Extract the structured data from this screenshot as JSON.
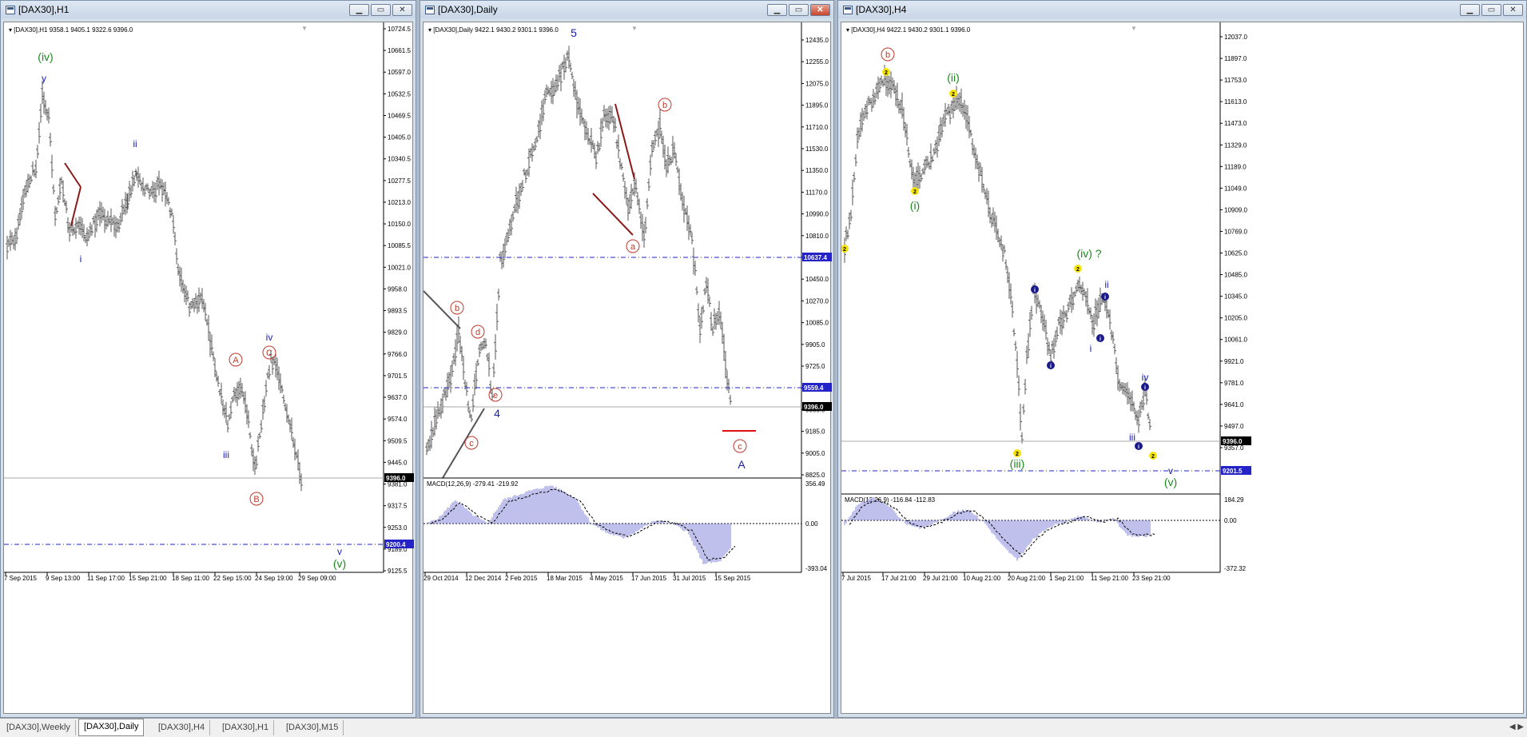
{
  "windows": [
    {
      "title": "[DAX30],H1",
      "info": "[DAX30],H1  9358.1 9405.1 9322.6 9396.0",
      "price_levels": [
        "10724.5",
        "10661.5",
        "10597.0",
        "10532.5",
        "10469.5",
        "10405.0",
        "10340.5",
        "10277.5",
        "10213.0",
        "10150.0",
        "10085.5",
        "10021.0",
        "9958.0",
        "9893.5",
        "9829.0",
        "9766.0",
        "9701.5",
        "9637.0",
        "9574.0",
        "9509.5",
        "9445.0",
        "9381.0",
        "9317.5",
        "9253.0",
        "9189.0",
        "9125.5"
      ],
      "time_labels": [
        "7 Sep 2015",
        "9 Sep 13:00",
        "11 Sep 17:00",
        "15 Sep 21:00",
        "18 Sep 11:00",
        "22 Sep 15:00",
        "24 Sep 19:00",
        "29 Sep 09:00"
      ],
      "hlines": [
        {
          "label": "9200.4",
          "value": 9200.4
        }
      ],
      "current_price": "9396.0",
      "wave_labels": {
        "iv_green": "(iv)",
        "y": "y",
        "ii": "ii",
        "i": "i",
        "iii": "iii",
        "A_circ": "A",
        "B_circ": "B",
        "C_circ": "C",
        "iv": "iv",
        "v": "v",
        "v_green": "(v)"
      }
    },
    {
      "title": "[DAX30],Daily",
      "info": "[DAX30],Daily  9422.1 9430.2 9301.1 9396.0",
      "price_levels": [
        "12435.0",
        "12255.0",
        "12075.0",
        "11895.0",
        "11710.0",
        "11530.0",
        "11350.0",
        "11170.0",
        "10990.0",
        "10810.0",
        "10630.0",
        "10450.0",
        "10270.0",
        "10085.0",
        "9905.0",
        "9725.0",
        "9545.0",
        "9365.0",
        "9185.0",
        "9005.0",
        "8825.0"
      ],
      "time_labels": [
        "29 Oct 2014",
        "12 Dec 2014",
        "2 Feb 2015",
        "18 Mar 2015",
        "4 May 2015",
        "17 Jun 2015",
        "31 Jul 2015",
        "15 Sep 2015"
      ],
      "hlines": [
        {
          "label": "10637.4",
          "value": 10637.4
        },
        {
          "label": "9559.4",
          "value": 9559.4
        }
      ],
      "current_price": "9396.0",
      "macd_info": "MACD(12,26,9) -279.41 -219.92",
      "macd_levels": [
        "356.49",
        "0.00",
        "-393.04"
      ],
      "wave_labels": {
        "five": "5",
        "four": "4",
        "A": "A",
        "a": "a",
        "b_top": "b",
        "b_left": "b",
        "c_left": "c",
        "c_right": "c",
        "d": "d",
        "e": "e"
      }
    },
    {
      "title": "[DAX30],H4",
      "info": "[DAX30],H4  9422.1 9430.2 9301.1 9396.0",
      "price_levels": [
        "12037.0",
        "11897.0",
        "11753.0",
        "11613.0",
        "11473.0",
        "11329.0",
        "11189.0",
        "11049.0",
        "10909.0",
        "10769.0",
        "10625.0",
        "10485.0",
        "10345.0",
        "10205.0",
        "10061.0",
        "9921.0",
        "9781.0",
        "9641.0",
        "9497.0",
        "9357.0"
      ],
      "time_labels": [
        "7 Jul 2015",
        "17 Jul 21:00",
        "29 Jul 21:00",
        "10 Aug 21:00",
        "20 Aug 21:00",
        "1 Sep 21:00",
        "11 Sep 21:00",
        "23 Sep 21:00"
      ],
      "hlines": [
        {
          "label": "9201.5",
          "value": 9201.5
        }
      ],
      "current_price": "9396.0",
      "macd_info": "MACD(12,26,9) -116.84 -112.83",
      "macd_levels": [
        "184.29",
        "0.00",
        "-372.32"
      ],
      "wave_labels": {
        "b": "b",
        "ii_green": "(ii)",
        "i_green": "(i)",
        "iv_green": "(iv) ?",
        "iii_green": "(iii)",
        "v_green": "(v)",
        "ii": "ii",
        "i": "i",
        "iv": "iv",
        "iii": "iii",
        "v": "v"
      }
    }
  ],
  "tabs": [
    "[DAX30],Weekly",
    "[DAX30],Daily",
    "[DAX30],H4",
    "[DAX30],H1",
    "[DAX30],M15"
  ],
  "active_tab": "[DAX30],Daily",
  "colors": {
    "bars": "#555555",
    "wave_red": "#c0392b",
    "wave_blue": "#1a1ab4",
    "wave_green": "#1a8a1a",
    "hline": "#2323c8",
    "macd": "#8080d8"
  }
}
